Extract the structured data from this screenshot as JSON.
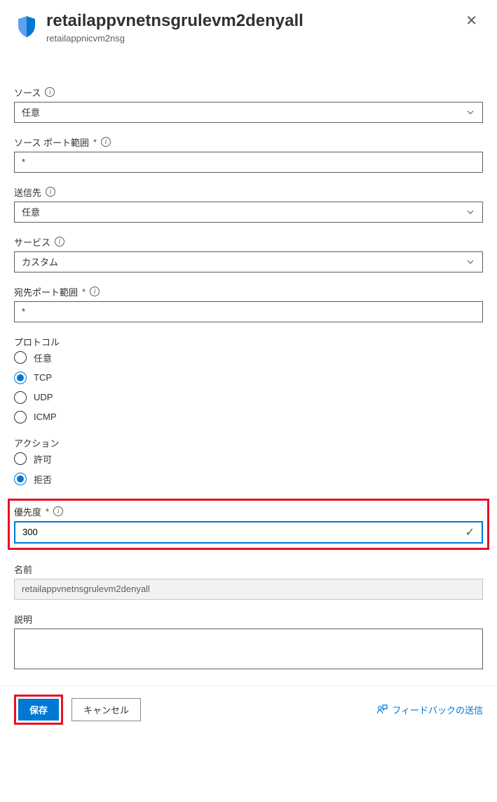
{
  "header": {
    "title": "retailappvnetnsgrulevm2denyall",
    "subtitle": "retailappnicvm2nsg"
  },
  "fields": {
    "source": {
      "label": "ソース",
      "value": "任意"
    },
    "sourcePortRange": {
      "label": "ソース ポート範囲",
      "value": "*"
    },
    "destination": {
      "label": "送信先",
      "value": "任意"
    },
    "service": {
      "label": "サービス",
      "value": "カスタム"
    },
    "destPortRange": {
      "label": "宛先ポート範囲",
      "value": "*"
    },
    "protocol": {
      "label": "プロトコル",
      "options": {
        "any": "任意",
        "tcp": "TCP",
        "udp": "UDP",
        "icmp": "ICMP"
      },
      "selected": "tcp"
    },
    "action": {
      "label": "アクション",
      "options": {
        "allow": "許可",
        "deny": "拒否"
      },
      "selected": "deny"
    },
    "priority": {
      "label": "優先度",
      "value": "300"
    },
    "name": {
      "label": "名前",
      "value": "retailappvnetnsgrulevm2denyall"
    },
    "description": {
      "label": "説明",
      "value": ""
    }
  },
  "footer": {
    "save": "保存",
    "cancel": "キャンセル",
    "feedback": "フィードバックの送信"
  }
}
